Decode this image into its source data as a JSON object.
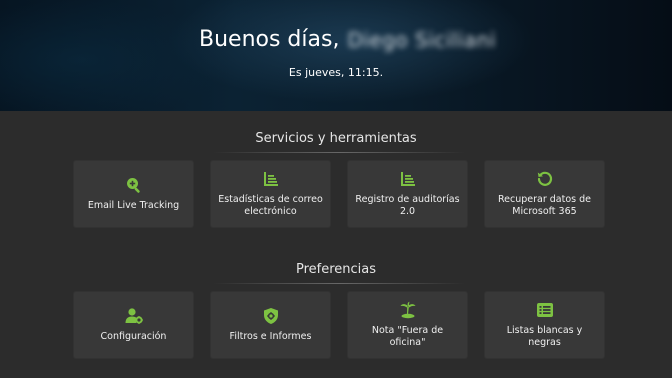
{
  "header": {
    "greeting": "Buenos días,",
    "user_name": "Diego Siciliani",
    "date_text": "Es jueves, 11:15."
  },
  "sections": [
    {
      "title": "Servicios y herramientas",
      "cards": [
        {
          "label": "Email Live Tracking",
          "icon": "search-plus-icon"
        },
        {
          "label": "Estadísticas de correo electrónico",
          "icon": "chart-list-icon"
        },
        {
          "label": "Registro de auditorías 2.0",
          "icon": "chart-list-icon"
        },
        {
          "label": "Recuperar datos de Microsoft 365",
          "icon": "restore-icon"
        }
      ]
    },
    {
      "title": "Preferencias",
      "cards": [
        {
          "label": "Configuración",
          "icon": "user-gear-icon"
        },
        {
          "label": "Filtros e Informes",
          "icon": "shield-gear-icon"
        },
        {
          "label": "Nota \"Fuera de oficina\"",
          "icon": "island-icon"
        },
        {
          "label": "Listas blancas y negras",
          "icon": "list-icon"
        }
      ]
    }
  ],
  "colors": {
    "accent": "#7dc242",
    "background": "#2c2c2c",
    "card": "#383838"
  }
}
